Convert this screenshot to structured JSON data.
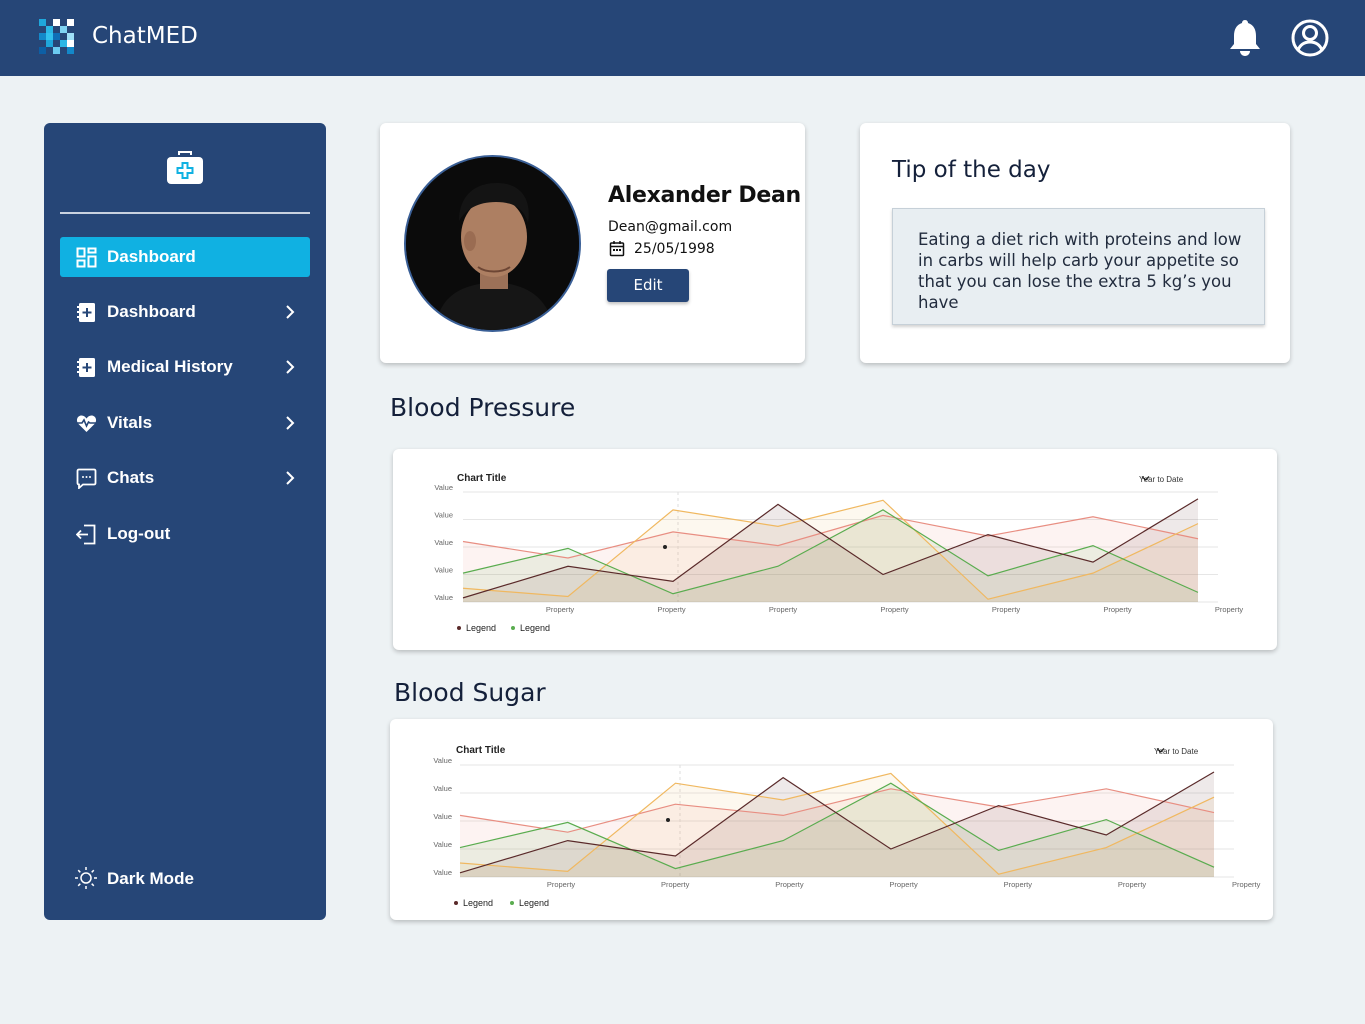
{
  "app": {
    "brand": "ChatMED",
    "icons": {
      "logo": "chatmed-logo-mosaic",
      "notifications": "bell-icon",
      "profile": "user-circle-icon"
    },
    "colors": {
      "nav": "#264677",
      "accent": "#10b1e2",
      "page_bg": "#edf2f4"
    }
  },
  "sidebar": {
    "header_icon": "medical-kit-icon",
    "items": [
      {
        "label": "Dashboard",
        "icon": "dashboard-grid-icon",
        "active": true,
        "has_chevron": false
      },
      {
        "label": "Dashboard",
        "icon": "medical-book-icon",
        "active": false,
        "has_chevron": true
      },
      {
        "label": "Medical History",
        "icon": "medical-book-icon",
        "active": false,
        "has_chevron": true
      },
      {
        "label": "Vitals",
        "icon": "heartbeat-icon",
        "active": false,
        "has_chevron": true
      },
      {
        "label": "Chats",
        "icon": "chat-bubble-icon",
        "active": false,
        "has_chevron": true
      },
      {
        "label": "Log-out",
        "icon": "logout-icon",
        "active": false,
        "has_chevron": false
      }
    ],
    "dark_mode": {
      "label": "Dark Mode",
      "icon": "sun-icon"
    }
  },
  "profile": {
    "name": "Alexander Dean",
    "email": "Dean@gmail.com",
    "dob": "25/05/1998",
    "edit_label": "Edit"
  },
  "tip": {
    "title": "Tip of the day",
    "text": "Eating a diet rich with proteins and low in carbs will help carb your appetite so that you can lose the extra 5 kg’s you have"
  },
  "sections": {
    "blood_pressure": "Blood Pressure",
    "blood_sugar": "Blood Sugar"
  },
  "charts": [
    {
      "title": "Chart Title",
      "range": "Year to Date",
      "legend": [
        "Legend",
        "Legend"
      ]
    },
    {
      "title": "Chart Title",
      "range": "Year to Date",
      "legend": [
        "Legend",
        "Legend"
      ]
    }
  ],
  "chart_data": [
    {
      "type": "area",
      "title": "Chart Title",
      "y_tick_labels": [
        "Value",
        "Value",
        "Value",
        "Value",
        "Value"
      ],
      "x_tick_labels": [
        "Property",
        "Property",
        "Property",
        "Property",
        "Property",
        "Property",
        "Property"
      ],
      "ylim": [
        0,
        4
      ],
      "grid": true,
      "legend_position": "bottom-left",
      "series": [
        {
          "color": "#5a2a2a",
          "values": [
            0.15,
            1.3,
            0.75,
            3.55,
            1.0,
            2.45,
            1.45,
            3.75
          ]
        },
        {
          "color": "#5aac4f",
          "values": [
            1.05,
            1.95,
            0.3,
            1.3,
            3.35,
            0.95,
            2.05,
            0.35
          ]
        },
        {
          "color": "#f0b860",
          "values": [
            0.5,
            0.2,
            3.35,
            2.75,
            3.7,
            0.1,
            1.05,
            2.85
          ]
        },
        {
          "color": "#e88e82",
          "values": [
            2.2,
            1.6,
            2.55,
            2.05,
            3.15,
            2.4,
            3.1,
            2.3
          ]
        }
      ]
    },
    {
      "type": "area",
      "title": "Chart Title",
      "y_tick_labels": [
        "Value",
        "Value",
        "Value",
        "Value",
        "Value"
      ],
      "x_tick_labels": [
        "Property",
        "Property",
        "Property",
        "Property",
        "Property",
        "Property",
        "Property"
      ],
      "ylim": [
        0,
        4
      ],
      "grid": true,
      "legend_position": "bottom-left",
      "series": [
        {
          "color": "#5a2a2a",
          "values": [
            0.15,
            1.3,
            0.75,
            3.55,
            1.0,
            2.55,
            1.5,
            3.75
          ]
        },
        {
          "color": "#5aac4f",
          "values": [
            1.05,
            1.95,
            0.3,
            1.3,
            3.35,
            0.95,
            2.05,
            0.35
          ]
        },
        {
          "color": "#f0b860",
          "values": [
            0.5,
            0.2,
            3.35,
            2.75,
            3.7,
            0.1,
            1.05,
            2.85
          ]
        },
        {
          "color": "#e88e82",
          "values": [
            2.2,
            1.6,
            2.6,
            2.2,
            3.15,
            2.5,
            3.15,
            2.3
          ]
        }
      ]
    }
  ]
}
